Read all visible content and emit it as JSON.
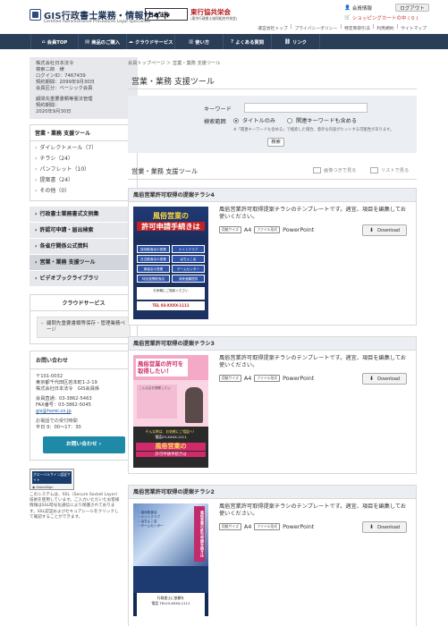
{
  "header": {
    "site_title": "GIS行政書士業務・情報サイト",
    "site_subtitle": "Certified Administrative Procedures Legal Specialists",
    "partner1": "日本法令",
    "partner2": "東行協共栄会",
    "partner2_sub": "(東京行政書士協同組合共栄会)",
    "member_info_label": "会員情報",
    "logout_label": "ログアウト",
    "cart_label": "ショッピングカートの中 ( 0 )",
    "links": [
      "運営会社トップ",
      "プライバシーポリシー",
      "特定商取引法",
      "利用規約",
      "サイトマップ"
    ]
  },
  "nav": {
    "items": [
      {
        "label": "会員TOP",
        "icon": "home-icon"
      },
      {
        "label": "商品のご購入",
        "icon": "cart-icon"
      },
      {
        "label": "クラウドサービス",
        "icon": "cloud-icon"
      },
      {
        "label": "使い方",
        "icon": "book-icon"
      },
      {
        "label": "よくある質問",
        "icon": "question-icon"
      },
      {
        "label": "リンク",
        "icon": "link-icon"
      }
    ]
  },
  "user": {
    "company": "株式会社日本法令",
    "name": "検索二郎　様",
    "login_id": "ログインID：7467439",
    "expiry": "契約期間：2099年9月30日",
    "member_type": "会員区分：ベーシック会員",
    "plan_name": "顧問先重要書類等憲法管理",
    "plan_period_label": "契約期間：",
    "plan_period": "2020年9月30日"
  },
  "sidebar": {
    "category_title": "営業・業務 支援ツール",
    "subcategories": [
      "ダイレクトメール（7）",
      "チラシ（24）",
      "パンフレット（10）",
      "提案書（24）",
      "その他（0）"
    ],
    "menu": [
      "行政書士業務書式文例集",
      "許認可申請・届出検索",
      "各省庁関係公式資料",
      "営業・業務 支援ツール",
      "ビデオブックライブラリ"
    ],
    "cloud_title": "クラウドサービス",
    "cloud_item": "顧問先重要書類等保存・管理業務ページ",
    "contact_title": "お問い合わせ",
    "contact_lines": [
      "〒101-0032",
      "東京都千代田区岩本町1-2-19",
      "株式会社日本法令　GIS会員係"
    ],
    "tel": "会員直通：03-3862-5463",
    "fax": "FAX番号：03-3862-5045",
    "email": "gis@horei.co.jp",
    "hours_label": "お電話での受付時間",
    "hours": "平日 9：00～17：30",
    "contact_button": "お問い合わせ",
    "ssl_label": "グローバルサイン認証サイト",
    "ssl_text": "このシステムは、SSL（Secure Socket Layer）技術を使用しています。ご入力いただいたお客様情報はSSL暗号化通信により保護されております。SSL認証およびセキュアシールをクリックして確認することができます。"
  },
  "main": {
    "breadcrumb": "会員トップページ ＞ 営業・業務 支援ツール",
    "title": "営業・業務 支援ツール",
    "search": {
      "keyword_label": "キーワード",
      "keyword_value": "",
      "scope_label": "検索範囲",
      "option1": "タイトルのみ",
      "option2": "関連キーワードも含める",
      "note": "※「関連キーワードも含める」で検索した場合、意外な内容がヒットする可能性があります。",
      "button": "検索"
    },
    "list_title": "営業・業務 支援ツール",
    "view_grid": "画像つきで見る",
    "view_list": "リストで見る"
  },
  "cards": [
    {
      "title": "風俗営業許可取得の提案チラシ4",
      "desc": "風俗営業許可取得提案チラシのテンプレートです。適宜、項目を編集してお使いください。",
      "size_tag": "用紙サイズ",
      "size": "A4",
      "format_tag": "ファイル形式",
      "format": "PowerPoint",
      "download": "Download",
      "flyer": {
        "l1": "風俗営業の",
        "l2": "許可申請手続きは",
        "cells": [
          "接待飲食店の営業",
          "ナイトクラブ",
          "社交飲食店の営業",
          "ぱちんこ店",
          "麻雀店の営業",
          "ゲームセンター",
          "特定遊興飲食店",
          "深夜酒類提供"
        ],
        "box": "お気軽にご相談ください",
        "tel": "TEL 03-XXXX-1111"
      }
    },
    {
      "title": "風俗営業許可取得の提案チラシ3",
      "desc": "風俗営業許可取得提案チラシのテンプレートです。適宜、項目を編集してお使いください。",
      "size_tag": "用紙サイズ",
      "size": "A4",
      "format_tag": "ファイル形式",
      "format": "PowerPoint",
      "download": "Download",
      "flyer": {
        "l1": "風俗営業の許可を取得したい！",
        "mid": "こんな店を開業したい",
        "t1": "そんな時は、お気軽にご相談へ！",
        "t2": "電話03-XXXX-1111",
        "t3": "風俗営業の",
        "t4": "許可申請手続きは"
      }
    },
    {
      "title": "風俗営業許可取得の提案チラシ2",
      "desc": "風俗営業許可取得提案チラシのテンプレートです。適宜、項目を編集してお使いください。",
      "size_tag": "用紙サイズ",
      "size": "A4",
      "format_tag": "ファイル形式",
      "format": "PowerPoint",
      "download": "Download",
      "flyer": {
        "list": "・接待飲食店\n・ナイトクラブ\n・ぱちんこ店\n・ゲームセンター",
        "vert": "風俗営業の許可申請手続きは",
        "bot": "行政書士に依頼を\n電話 TEL03-XXXX-1111"
      }
    }
  ]
}
